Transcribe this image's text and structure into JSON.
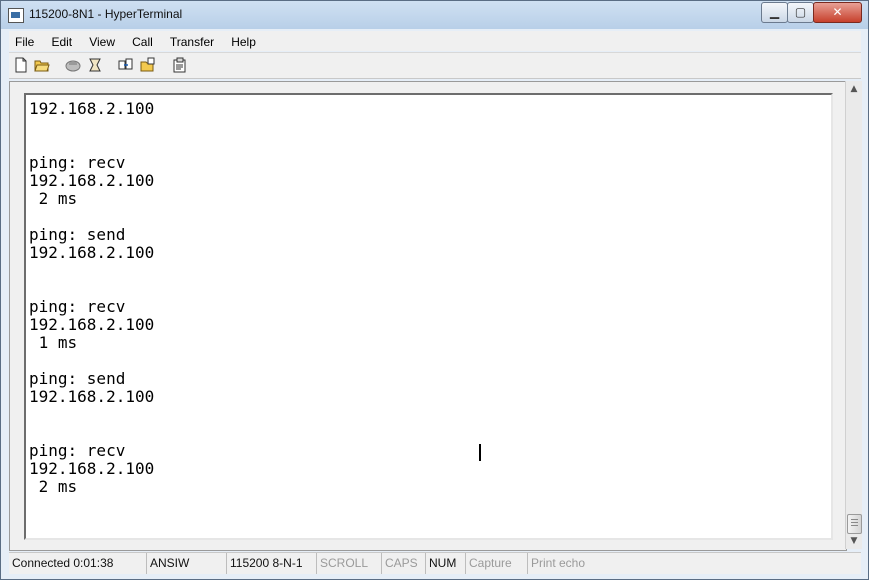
{
  "window": {
    "title": "115200-8N1 - HyperTerminal",
    "buttons": {
      "minimize": "▁",
      "maximize": "▢",
      "close": "✕"
    }
  },
  "menu": {
    "items": [
      "File",
      "Edit",
      "View",
      "Call",
      "Transfer",
      "Help"
    ]
  },
  "toolbar": {
    "icons": [
      "new-document-icon",
      "open-folder-icon",
      "connect-phone-icon",
      "disconnect-phone-icon",
      "send-icon",
      "receive-icon",
      "properties-icon"
    ]
  },
  "terminal": {
    "text": "192.168.2.100\n\n\nping: recv\n192.168.2.100\n 2 ms\n\nping: send\n192.168.2.100\n\n\nping: recv\n192.168.2.100\n 1 ms\n\nping: send\n192.168.2.100\n\n\nping: recv\n192.168.2.100\n 2 ms"
  },
  "statusbar": {
    "connected": "Connected 0:01:38",
    "emulation": "ANSIW",
    "port_settings": "115200 8-N-1",
    "scroll": "SCROLL",
    "caps": "CAPS",
    "num": "NUM",
    "capture": "Capture",
    "print_echo": "Print echo"
  },
  "colors": {
    "titlebar": "#c4d8ee",
    "close_button": "#c7402c",
    "terminal_bg": "#ffffff",
    "statusbar_dim_text": "#9a9a9a"
  }
}
